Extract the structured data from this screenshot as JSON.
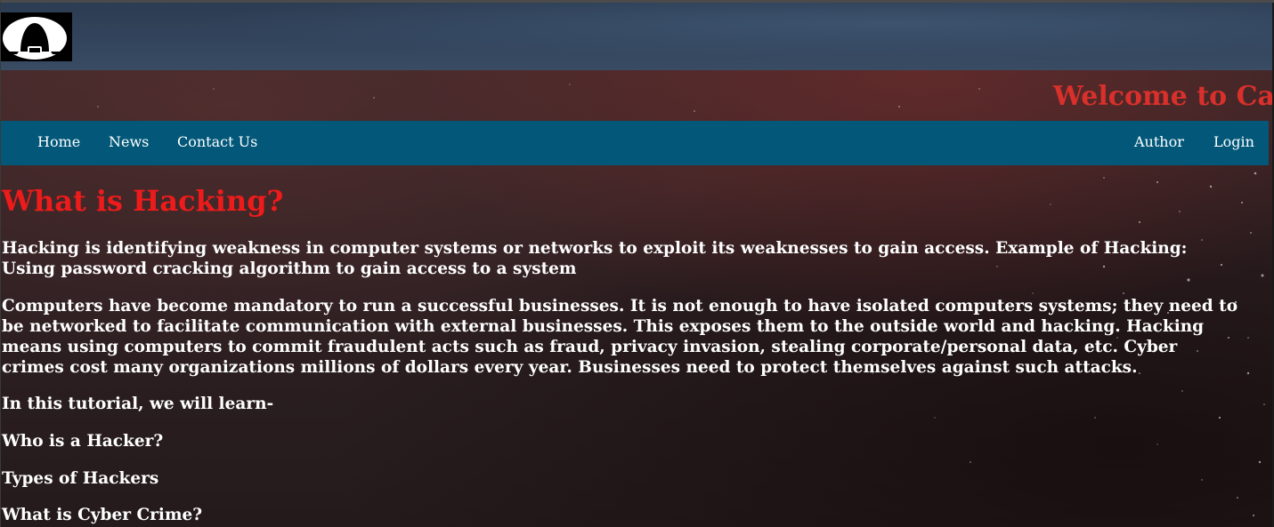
{
  "header": {
    "logo_icon": "hacker-hood-icon",
    "welcome_text": "Welcome to Ca"
  },
  "nav": {
    "left": [
      {
        "label": "Home"
      },
      {
        "label": "News"
      },
      {
        "label": "Contact Us"
      }
    ],
    "right": [
      {
        "label": "Author"
      },
      {
        "label": "Login"
      }
    ]
  },
  "main": {
    "title": "What is Hacking?",
    "paragraph1": [
      "Hacking is identifying weakness in computer systems or networks to exploit its weaknesses to gain access. Example of Hacking:",
      "Using password cracking algorithm to gain access to a system"
    ],
    "paragraph2": [
      "Computers have become mandatory to run a successful businesses. It is not enough to have isolated computers systems; they need to",
      "be networked to facilitate communication with external businesses. This exposes them to the outside world and hacking. Hacking",
      "means using computers to commit fraudulent acts such as fraud, privacy invasion, stealing corporate/personal data, etc. Cyber",
      "crimes cost many organizations millions of dollars every year. Businesses need to protect themselves against such attacks."
    ],
    "intro": "In this tutorial, we will learn-",
    "topics": [
      "Who is a Hacker?",
      "Types of Hackers",
      "What is Cyber Crime?"
    ]
  },
  "colors": {
    "header_blue": "#32445c",
    "nav_teal": "#03587a",
    "welcome_red": "#d9302b",
    "title_red": "#ee1b1b",
    "text_white": "#ffffff",
    "background_dark": "#2f2123"
  }
}
